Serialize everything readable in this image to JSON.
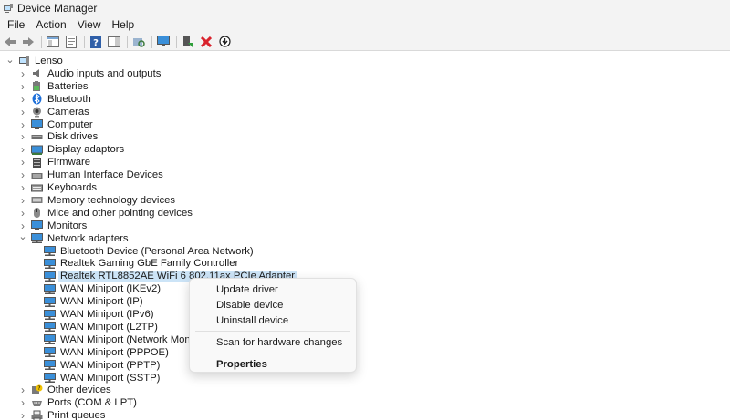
{
  "window": {
    "title": "Device Manager"
  },
  "menu": [
    "File",
    "Action",
    "View",
    "Help"
  ],
  "toolbar": {
    "buttons": [
      "back-icon",
      "forward-icon",
      "show-hide-console-tree-icon",
      "properties-icon",
      "help-icon",
      "action-pane-icon",
      "scan-hardware-icon",
      "monitor-icon",
      "update-driver-icon",
      "uninstall-icon",
      "disable-icon"
    ]
  },
  "tree": {
    "root": "Lenso",
    "categories": [
      {
        "label": "Audio inputs and outputs",
        "icon": "speaker-icon"
      },
      {
        "label": "Batteries",
        "icon": "battery-icon"
      },
      {
        "label": "Bluetooth",
        "icon": "bluetooth-icon"
      },
      {
        "label": "Cameras",
        "icon": "camera-icon"
      },
      {
        "label": "Computer",
        "icon": "computer-icon"
      },
      {
        "label": "Disk drives",
        "icon": "disk-icon"
      },
      {
        "label": "Display adaptors",
        "icon": "display-adapter-icon"
      },
      {
        "label": "Firmware",
        "icon": "firmware-icon"
      },
      {
        "label": "Human Interface Devices",
        "icon": "hid-icon"
      },
      {
        "label": "Keyboards",
        "icon": "keyboard-icon"
      },
      {
        "label": "Memory technology devices",
        "icon": "memory-icon"
      },
      {
        "label": "Mice and other pointing devices",
        "icon": "mouse-icon"
      },
      {
        "label": "Monitors",
        "icon": "monitor-icon"
      },
      {
        "label": "Network adapters",
        "icon": "network-icon"
      }
    ],
    "network_adapters": [
      "Bluetooth Device (Personal Area Network)",
      "Realtek Gaming GbE Family Controller",
      "Realtek RTL8852AE WiFi 6 802.11ax PCIe Adapter",
      "WAN Miniport (IKEv2)",
      "WAN Miniport (IP)",
      "WAN Miniport (IPv6)",
      "WAN Miniport (L2TP)",
      "WAN Miniport (Network Monitor)",
      "WAN Miniport (PPPOE)",
      "WAN Miniport (PPTP)",
      "WAN Miniport (SSTP)"
    ],
    "after": [
      {
        "label": "Other devices",
        "icon": "other-devices-icon"
      },
      {
        "label": "Ports (COM & LPT)",
        "icon": "port-icon"
      },
      {
        "label": "Print queues",
        "icon": "printer-icon"
      }
    ],
    "selected_index": 2
  },
  "context_menu": {
    "items": [
      "Update driver",
      "Disable device",
      "Uninstall device",
      "Scan for hardware changes",
      "Properties"
    ]
  },
  "colors": {
    "selection": "#cce4f7",
    "chrome": "#f3f3f3",
    "accent": "#0078d4",
    "delete": "#d9232d"
  }
}
